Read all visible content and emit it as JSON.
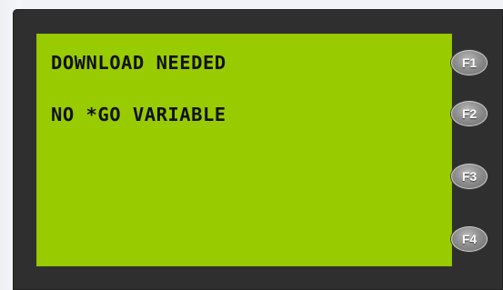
{
  "display": {
    "line1": "DOWNLOAD NEEDED",
    "line2": "NO *GO VARIABLE"
  },
  "function_keys": [
    {
      "label": "F1"
    },
    {
      "label": "F2"
    },
    {
      "label": "F3"
    },
    {
      "label": "F4"
    }
  ],
  "colors": {
    "lcd_background": "#99cc00",
    "lcd_text": "#111111",
    "device_bezel": "#2f2f2f",
    "key_face": "#8f8f8f"
  }
}
